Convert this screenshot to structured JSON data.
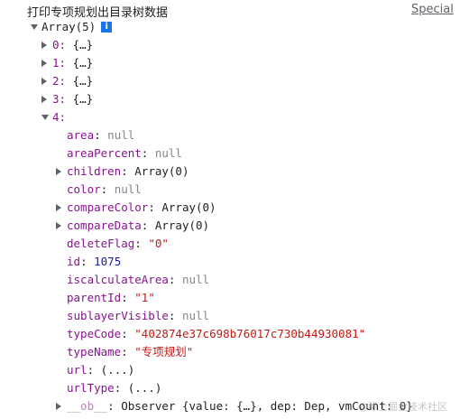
{
  "console": {
    "message": "打印专项规划出目录树数据",
    "source_link": "Special",
    "array_label": "Array(5)",
    "info_icon_glyph": "i",
    "collapsed_items": [
      {
        "index": "0:",
        "value": "{…}"
      },
      {
        "index": "1:",
        "value": "{…}"
      },
      {
        "index": "2:",
        "value": "{…}"
      },
      {
        "index": "3:",
        "value": "{…}"
      }
    ],
    "expanded_index": "4:",
    "properties": [
      {
        "key": "area",
        "value": "null",
        "kind": "null"
      },
      {
        "key": "areaPercent",
        "value": "null",
        "kind": "null"
      },
      {
        "key": "children",
        "value": "Array(0)",
        "kind": "plain",
        "expandable": true
      },
      {
        "key": "color",
        "value": "null",
        "kind": "null"
      },
      {
        "key": "compareColor",
        "value": "Array(0)",
        "kind": "plain",
        "expandable": true
      },
      {
        "key": "compareData",
        "value": "Array(0)",
        "kind": "plain",
        "expandable": true
      },
      {
        "key": "deleteFlag",
        "value": "\"0\"",
        "kind": "str"
      },
      {
        "key": "id",
        "value": "1075",
        "kind": "num"
      },
      {
        "key": "iscalculateArea",
        "value": "null",
        "kind": "null"
      },
      {
        "key": "parentId",
        "value": "\"1\"",
        "kind": "str"
      },
      {
        "key": "sublayerVisible",
        "value": "null",
        "kind": "null"
      },
      {
        "key": "typeCode",
        "value": "\"402874e37c698b76017c730b44930081\"",
        "kind": "str"
      },
      {
        "key": "typeName",
        "value": "\"专项规划\"",
        "kind": "str"
      },
      {
        "key": "url",
        "value": "(...)",
        "kind": "plain"
      },
      {
        "key": "urlType",
        "value": "(...)",
        "kind": "plain"
      },
      {
        "key": "__ob__",
        "value": "Observer {value: {…}, dep: Dep, vmCount: 0}",
        "kind": "plain",
        "expandable": true,
        "dim": true
      }
    ],
    "watermark": "@稀土掘金技术社区"
  }
}
